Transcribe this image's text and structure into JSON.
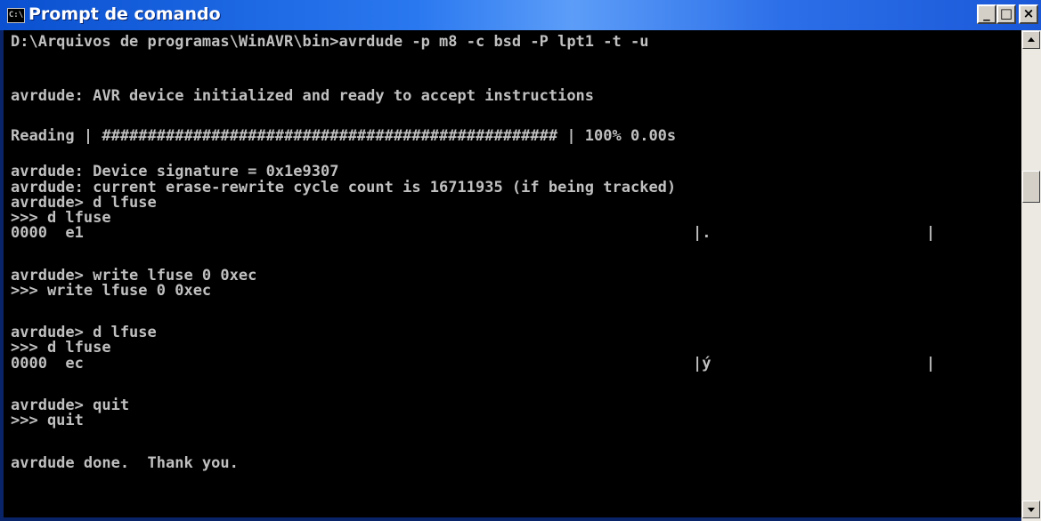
{
  "window": {
    "title": "Prompt de comando",
    "icon": "cmd-icon",
    "icon_text": "C:\\",
    "buttons": {
      "minimize": "_",
      "maximize": "□",
      "close": "×"
    }
  },
  "console": {
    "lines": [
      "D:\\Arquivos de programas\\WinAVR\\bin>avrdude -p m8 -c bsd -P lpt1 -t -u",
      "",
      "avrdude: AVR device initialized and ready to accept instructions",
      "",
      "Reading | ################################################## | 100% 0.00s",
      "",
      "avrdude: Device signature = 0x1e9307",
      "avrdude: current erase-rewrite cycle count is 16711935 (if being tracked)",
      "avrdude> d lfuse",
      ">>> d lfuse",
      "0000  e1",
      "",
      "avrdude> write lfuse 0 0xec",
      ">>> write lfuse 0 0xec",
      "",
      "avrdude> d lfuse",
      ">>> d lfuse",
      "0000  ec",
      "",
      "avrdude> quit",
      ">>> quit",
      "",
      "avrdude done.  Thank you."
    ],
    "dump_ascii": {
      "first": {
        "left": "|.",
        "right": "|"
      },
      "second": {
        "left": "|ý",
        "right": "|"
      }
    }
  },
  "colors": {
    "console_bg": "#000000",
    "console_fg": "#c0c0c0",
    "titlebar": "#0a50d0"
  }
}
